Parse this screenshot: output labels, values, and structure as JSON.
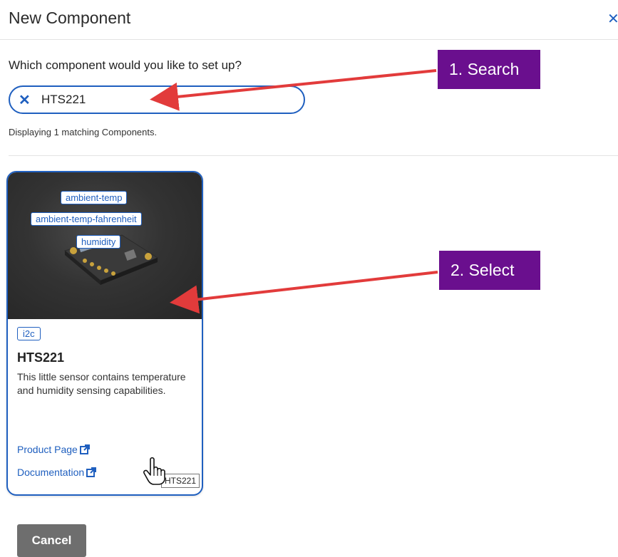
{
  "dialog": {
    "title": "New Component",
    "close_icon": "close-icon"
  },
  "search": {
    "question": "Which component would you like to set up?",
    "value": "HTS221",
    "clear_icon": "close-icon",
    "results_text": "Displaying 1 matching Components."
  },
  "component_card": {
    "image_tags": [
      "ambient-temp",
      "ambient-temp-fahrenheit",
      "humidity"
    ],
    "interface_badge": "i2c",
    "title": "HTS221",
    "description": "This little sensor contains temperature and humidity sensing capabilities.",
    "product_page_label": "Product Page",
    "documentation_label": "Documentation",
    "link_icon": "external-link-icon"
  },
  "tooltip": "HTS221",
  "annotations": {
    "step1": "1. Search",
    "step2": "2. Select"
  },
  "footer": {
    "cancel_label": "Cancel"
  },
  "colors": {
    "accent": "#1f5fbf",
    "callout": "#6a0f8e",
    "arrow": "#e23b3b",
    "cancel_button": "#6e6e6e"
  }
}
